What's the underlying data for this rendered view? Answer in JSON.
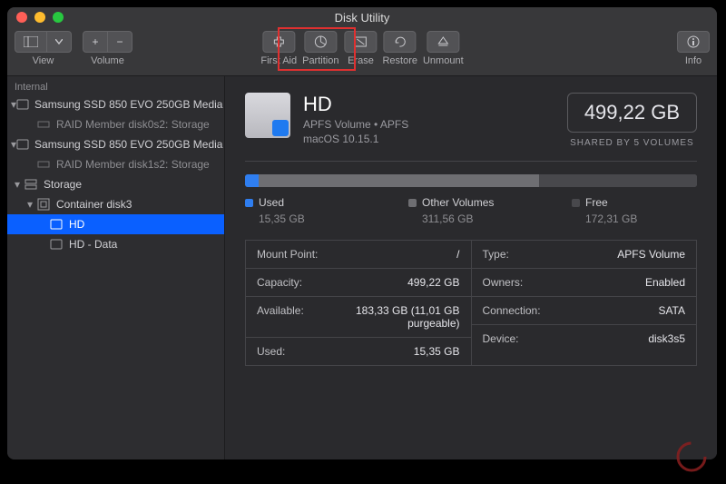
{
  "window": {
    "title": "Disk Utility"
  },
  "toolbar": {
    "view": "View",
    "volume": "Volume",
    "center": [
      {
        "key": "firstaid",
        "label": "First Aid"
      },
      {
        "key": "partition",
        "label": "Partition"
      },
      {
        "key": "erase",
        "label": "Erase"
      },
      {
        "key": "restore",
        "label": "Restore"
      },
      {
        "key": "unmount",
        "label": "Unmount"
      }
    ],
    "info": "Info"
  },
  "sidebar": {
    "header": "Internal",
    "drive1": "Samsung SSD 850 EVO 250GB Media",
    "drive1_sub": "RAID Member disk0s2: Storage",
    "drive2": "Samsung SSD 850 EVO 250GB Media",
    "drive2_sub": "RAID Member disk1s2: Storage",
    "storage": "Storage",
    "container": "Container disk3",
    "hd": "HD",
    "hddata": "HD - Data"
  },
  "volume": {
    "name": "HD",
    "subtitle": "APFS Volume • APFS",
    "os": "macOS 10.15.1",
    "capacity": "499,22 GB",
    "shared": "SHARED BY 5 VOLUMES"
  },
  "usage": {
    "used": {
      "label": "Used",
      "value": "15,35 GB",
      "color": "#2f7ef0",
      "pct": 3
    },
    "other": {
      "label": "Other Volumes",
      "value": "311,56 GB",
      "color": "#6e6e72",
      "pct": 62
    },
    "free": {
      "label": "Free",
      "value": "172,31 GB",
      "color": "#48484c",
      "pct": 35
    }
  },
  "info": {
    "left": [
      {
        "k": "Mount Point:",
        "v": "/"
      },
      {
        "k": "Capacity:",
        "v": "499,22 GB"
      },
      {
        "k": "Available:",
        "v": "183,33 GB (11,01 GB purgeable)"
      },
      {
        "k": "Used:",
        "v": "15,35 GB"
      }
    ],
    "right": [
      {
        "k": "Type:",
        "v": "APFS Volume"
      },
      {
        "k": "Owners:",
        "v": "Enabled"
      },
      {
        "k": "Connection:",
        "v": "SATA"
      },
      {
        "k": "Device:",
        "v": "disk3s5"
      }
    ]
  }
}
